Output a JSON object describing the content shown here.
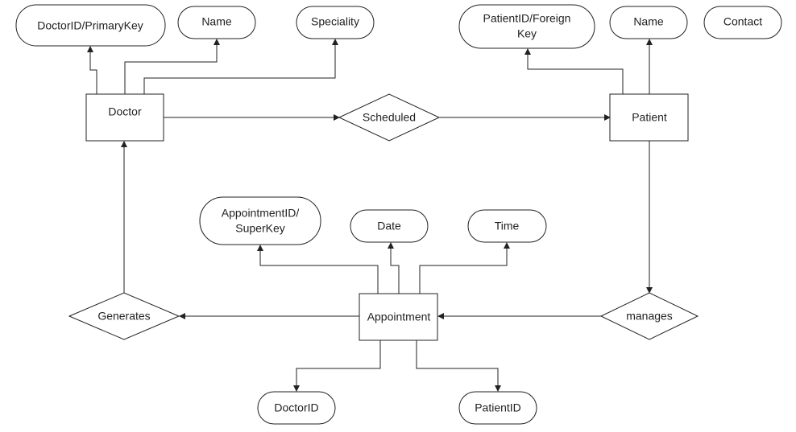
{
  "entities": {
    "doctor": "Doctor",
    "patient": "Patient",
    "appointment": "Appointment"
  },
  "relationships": {
    "scheduled": "Scheduled",
    "generates": "Generates",
    "manages": "manages"
  },
  "attributes": {
    "doctor_id_primary_key": "DoctorID/PrimaryKey",
    "doctor_name": "Name",
    "speciality": "Speciality",
    "patient_id_foreign_key_line1": "PatientID/Foreign",
    "patient_id_foreign_key_line2": "Key",
    "patient_name": "Name",
    "contact": "Contact",
    "appointment_id_line1": "AppointmentID/",
    "appointment_id_line2": "SuperKey",
    "date": "Date",
    "time": "Time",
    "appointment_doctor_id": "DoctorID",
    "appointment_patient_id": "PatientID"
  },
  "colors": {
    "stroke": "#222222",
    "fill": "#ffffff"
  }
}
